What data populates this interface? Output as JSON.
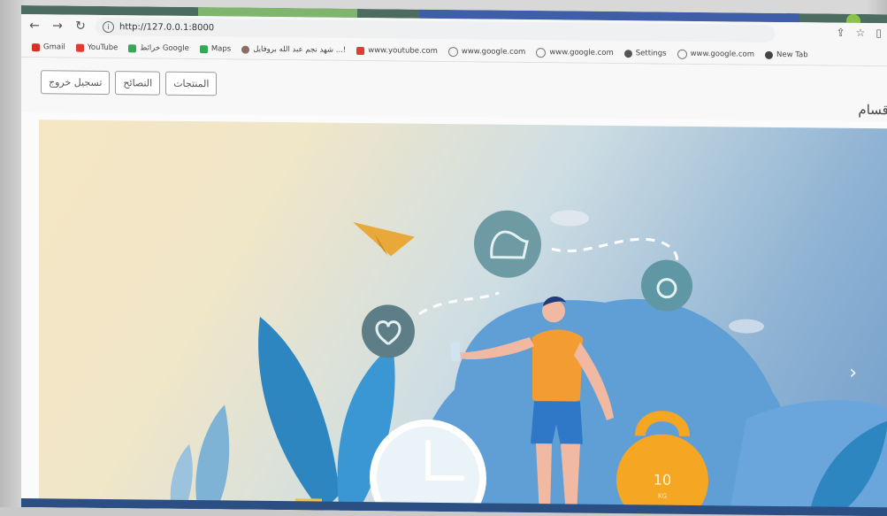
{
  "browser": {
    "url": "http://127.0.0.1:8000",
    "bookmarks": [
      {
        "label": "Gmail",
        "color": "#d93025"
      },
      {
        "label": "YouTube",
        "color": "#e53935"
      },
      {
        "label": "خرائط Google",
        "color": "#34a853"
      },
      {
        "label": "Maps",
        "color": "#34a853"
      },
      {
        "label": "شهد نجم عبد الله بروفايل ...!",
        "color": "#8d6e63"
      },
      {
        "label": "www.youtube.com",
        "color": "#e53935"
      },
      {
        "label": "www.google.com",
        "color": "#777777"
      },
      {
        "label": "www.google.com",
        "color": "#777777"
      },
      {
        "label": "Settings",
        "color": "#555555"
      },
      {
        "label": "www.google.com",
        "color": "#777777"
      },
      {
        "label": "New Tab",
        "color": "#444444"
      }
    ]
  },
  "navbar": {
    "products_label": "المنتجات",
    "tips_label": "النصائح",
    "logout_label": "تسجيل خروج",
    "brand_text": "أقسام"
  },
  "hero": {
    "kettlebell_weight": "10",
    "kettlebell_unit": "KG"
  },
  "colors": {
    "accent_orange": "#f5a623",
    "hero_blue": "#6f9ccb",
    "circle_teal": "#6e9aa3"
  }
}
